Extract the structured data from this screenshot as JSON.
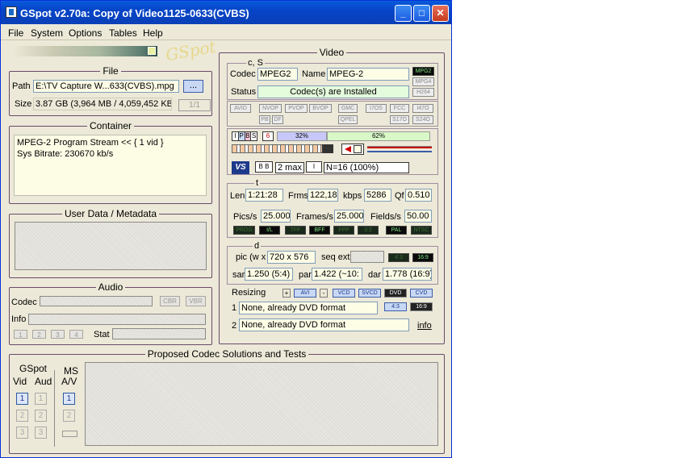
{
  "window": {
    "title": "GSpot v2.70a: Copy of Video1125-0633(CVBS)"
  },
  "menu": [
    "File",
    "System",
    "Options",
    "Tables",
    "Help"
  ],
  "logo_text": "GSpot",
  "file": {
    "legend": "File",
    "path_label": "Path",
    "path_value": "E:\\TV Capture W...633(CVBS).mpg",
    "browse_label": "...",
    "size_label": "Size",
    "size_value": "3.87 GB (3,964 MB / 4,059,452 KB",
    "page_indicator": "1/1"
  },
  "container": {
    "legend": "Container",
    "text": "MPEG-2 Program Stream << { 1 vid }\nSys Bitrate: 230670 kb/s"
  },
  "user_data": {
    "legend": "User Data / Metadata"
  },
  "audio": {
    "legend": "Audio",
    "codec_label": "Codec",
    "info_label": "Info",
    "cbr_label": "CBR",
    "vbr_label": "VBR",
    "stream_buttons": [
      "1",
      "2",
      "3",
      "4"
    ],
    "stat_label": "Stat"
  },
  "proposed": {
    "legend": "Proposed Codec Solutions and Tests",
    "gspot_label": "GSpot",
    "vid_label": "Vid",
    "aud_label": "Aud",
    "ms_label": "MS",
    "av_label": "A/V",
    "vid_buttons": [
      "1",
      "2",
      "3"
    ],
    "aud_buttons": [
      "1",
      "2",
      "3"
    ],
    "ms_buttons": [
      "1",
      "2"
    ]
  },
  "video": {
    "legend": "Video",
    "cs_legend": "c, S",
    "codec_label": "Codec",
    "codec_value": "MPEG2",
    "name_label": "Name",
    "name_value": "MPEG-2",
    "status_label": "Status",
    "status_value": "Codec(s) are Installed",
    "codec_tags": [
      "MPG2",
      "MPG4",
      "H264"
    ],
    "fourcc_tags_row1": [
      "AVID",
      "NVOP",
      "PVOP",
      "BVOP",
      "GMC",
      "I7OS",
      "FCC",
      "I47O"
    ],
    "fourcc_tags_row2": [
      "PB",
      "DF",
      "QPEL",
      "S17O",
      "S24O"
    ],
    "gop_types": [
      "I",
      "P",
      "B",
      "S"
    ],
    "gop_count": "6",
    "gop_pct_1": "32%",
    "gop_pct_2": "62%",
    "bframes_label": "2 max",
    "n_label": "N=16 (100%)",
    "vs_label": "VS",
    "t_legend": "t",
    "len_label": "Len",
    "len_value": "1:21:28",
    "frms_label": "Frms",
    "frms_value": "122,18",
    "kbps_label": "kbps",
    "kbps_value": "5286",
    "qf_label": "Qf",
    "qf_value": "0.510",
    "pics_label": "Pics/s",
    "pics_value": "25.000",
    "frames_label": "Frames/s",
    "frames_value": "25.000",
    "fields_label": "Fields/s",
    "fields_value": "50.00",
    "scan_tags": [
      "PROG",
      "I/L",
      "TFF",
      "BFF",
      "FPP",
      "3:2",
      "PAL",
      "NTSC"
    ],
    "d_legend": "d",
    "pic_label": "pic (w x",
    "pic_value": "720 x 576",
    "seqext_label": "seq ext",
    "ar_tags": [
      "4:3",
      "16:9"
    ],
    "sar_label": "sar",
    "sar_value": "1.250 (5:4)",
    "par_label": "par",
    "par_value": "1.422 (~10:",
    "dar_label": "dar",
    "dar_value": "1.778 (16:9)",
    "resizing_label": "Resizing",
    "resize_formats": [
      "AVI",
      "VCD",
      "SVCD",
      "DVD",
      "CVD"
    ],
    "resize_aspect": [
      "4:3",
      "16:9"
    ],
    "r1_label": "1",
    "r1_value": "None, already DVD format",
    "r2_label": "2",
    "r2_value": "None, already DVD format",
    "info_link": "info"
  }
}
